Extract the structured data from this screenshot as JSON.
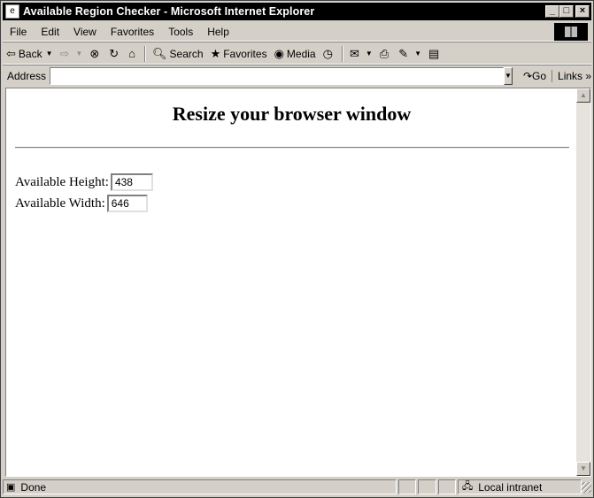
{
  "window": {
    "title": "Available Region Checker - Microsoft Internet Explorer",
    "controls": {
      "minimize": "_",
      "maximize": "□",
      "close": "×"
    }
  },
  "menu": [
    "File",
    "Edit",
    "View",
    "Favorites",
    "Tools",
    "Help"
  ],
  "toolbar": {
    "back_label": "Back",
    "search_label": "Search",
    "favorites_label": "Favorites",
    "media_label": "Media"
  },
  "address": {
    "label": "Address",
    "value": "",
    "go_label": "Go",
    "links_label": "Links"
  },
  "page": {
    "heading": "Resize your browser window",
    "height_label": "Available Height:",
    "height_value": "438",
    "width_label": "Available Width:",
    "width_value": "646"
  },
  "status": {
    "text": "Done",
    "zone": "Local intranet"
  },
  "icons": {
    "back": "back-arrow-icon",
    "forward": "forward-arrow-icon",
    "stop": "stop-icon",
    "refresh": "refresh-icon",
    "home": "home-icon",
    "search": "search-icon",
    "favorites": "favorites-icon",
    "media": "media-icon",
    "history": "history-icon",
    "mail": "mail-icon",
    "print": "print-icon",
    "edit": "edit-icon",
    "discuss": "discuss-icon",
    "go": "go-arrow-icon",
    "links": "chevron-right-icon",
    "page": "page-icon",
    "intranet": "intranet-icon"
  }
}
